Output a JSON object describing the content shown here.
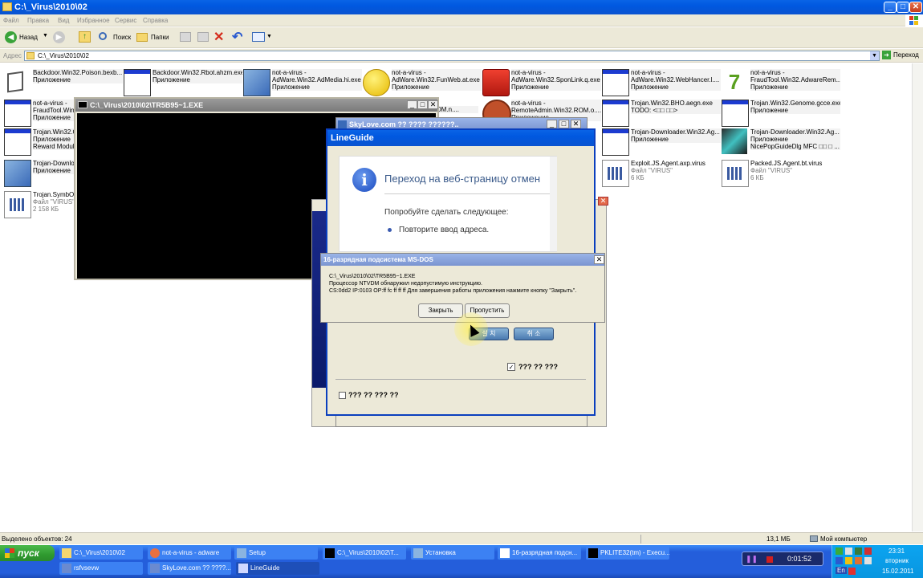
{
  "explorer": {
    "title": "C:\\_Virus\\2010\\02",
    "menu": [
      "Файл",
      "Правка",
      "Вид",
      "Избранное",
      "Сервис",
      "Справка"
    ],
    "toolbar": {
      "back": "Назад",
      "search": "Поиск",
      "folders": "Папки"
    },
    "address_label": "Адрес",
    "address_value": "C:\\_Virus\\2010\\02",
    "go_label": "Переход",
    "files": [
      {
        "name": "Backdoor.Win32.Poison.bexb...",
        "type": "Приложение",
        "icon": "app-window-icon"
      },
      {
        "name": "Backdoor.Win32.Rbot.ahzm.exe",
        "type": "Приложение",
        "icon": "app-window-icon"
      },
      {
        "name": "not-a-virus - AdWare.Win32.AdMedia.hi.exe",
        "type": "Приложение",
        "icon": "setup-icon"
      },
      {
        "name": "not-a-virus - AdWare.Win32.FunWeb.at.exe",
        "type": "Приложение",
        "icon": "smiley-icon"
      },
      {
        "name": "not-a-virus - AdWare.Win32.SponLink.q.exe",
        "type": "Приложение",
        "icon": "red-box-icon"
      },
      {
        "name": "not-a-virus - AdWare.Win32.WebHancer.l....",
        "type": "Приложение",
        "icon": "app-window-icon"
      },
      {
        "name": "not-a-virus - FraudTool.Win32.AdwareRem...",
        "type": "Приложение",
        "icon": "seven-icon"
      },
      {
        "name": "not-a-virus - FraudTool.Win3...",
        "type": "Приложение",
        "icon": "app-window-icon"
      },
      {
        "name": "...32.ROM.n....",
        "type": "",
        "icon": "app-window-icon"
      },
      {
        "name": "not-a-virus - RemoteAdmin.Win32.ROM.o....",
        "type": "Приложение",
        "icon": "remote-admin-icon"
      },
      {
        "name": "Trojan.Win32.BHO.aegn.exe",
        "type": "TODO: <□□ □□>",
        "icon": "app-window-icon"
      },
      {
        "name": "Trojan.Win32.Genome.gcce.exe",
        "type": "Приложение",
        "icon": "app-window-icon"
      },
      {
        "name": "Trojan.Win32.C...",
        "type": "Приложение",
        "sub": "Reward Module",
        "icon": "app-window-icon"
      },
      {
        "name": "Trojan-Downloader.Win32.Ag...",
        "type": "Приложение",
        "icon": "app-window-icon"
      },
      {
        "name": "Trojan-Downloader.Win32.Ag...",
        "type": "Приложение",
        "sub": "NicePopGuideDlg MFC □□ □ ...",
        "icon": "cubes-icon"
      },
      {
        "name": "Trojan-Downlo...",
        "type": "Приложение",
        "icon": "setup-icon"
      },
      {
        "name": "Exploit.JS.Agent.axp.virus",
        "type": "Файл \"VIRUS\"",
        "sub": "6 КБ",
        "icon": "file-icon"
      },
      {
        "name": "Packed.JS.Agent.bt.virus",
        "type": "Файл \"VIRUS\"",
        "sub": "6 КБ",
        "icon": "file-icon"
      },
      {
        "name": "Trojan.SymbOS...",
        "type": "Файл \"VIRUS\"",
        "sub": "2 158 КБ",
        "icon": "file-icon"
      }
    ],
    "status": {
      "selected": "Выделено объектов: 24",
      "size": "13,1 МБ",
      "location": "Мой компьютер"
    }
  },
  "dos_window": {
    "title": "C:\\_Virus\\2010\\02\\TR5B95~1.EXE"
  },
  "skylove": {
    "title": "SkyLove.com ?? ???? ??????.."
  },
  "lineguide": {
    "title": "LineGuide",
    "heading": "Переход на веб-страницу отмен",
    "suggest": "Попробуйте сделать следующее:",
    "bullet": "Повторите ввод адреса.",
    "install_btn": "설 치",
    "cancel_btn": "취 소",
    "check1": "??? ?? ???",
    "check2": "??? ?? ??? ??"
  },
  "ntvdm": {
    "title": "16-разрядная подсистема MS-DOS",
    "line1": "C:\\_Virus\\2010\\02\\TR5B95~1.EXE",
    "line2": "Процессор NTVDM обнаружил недопустимую инструкцию.",
    "line3": "CS:0dd2 IP:0103 OP:ff fc ff ff ff Для завершения работы приложения нажмите кнопку \"Закрыть\".",
    "close_btn": "Закрыть",
    "skip_btn": "Пропустить"
  },
  "taskbar": {
    "start": "пуск",
    "row1": [
      "C:\\_Virus\\2010\\02",
      "not-a-virus - adware",
      "Setup",
      "C:\\_Virus\\2010\\02\\T...",
      "Установка",
      "16-разрядная подсн...",
      "PKLITE32(tm) - Execu..."
    ],
    "row2": [
      "rsfvsevw",
      "SkyLove.com ?? ????...",
      "LineGuide"
    ],
    "timer": "0:01:52",
    "lang": "En",
    "time": "23:31",
    "day": "вторник",
    "date": "15.02.2011"
  }
}
